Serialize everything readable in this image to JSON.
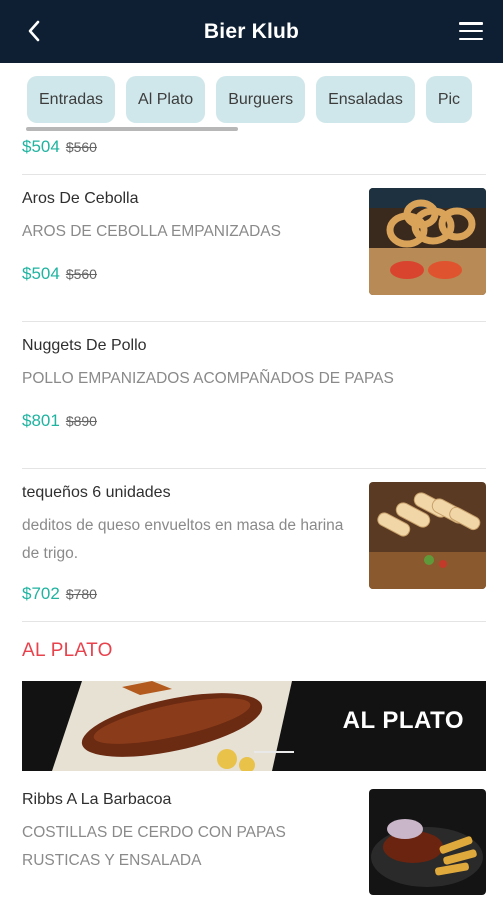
{
  "header": {
    "title": "Bier Klub",
    "back_icon": "chevron-left-icon",
    "menu_icon": "hamburger-menu-icon"
  },
  "tabs": [
    "Entradas",
    "Al Plato",
    "Burguers",
    "Ensaladas",
    "Pic"
  ],
  "items": [
    {
      "price": "$504",
      "old_price": "$560"
    },
    {
      "name": "Aros De Cebolla",
      "description": "AROS DE CEBOLLA EMPANIZADAS",
      "price": "$504",
      "old_price": "$560"
    },
    {
      "name": "Nuggets De Pollo",
      "description": "POLLO EMPANIZADOS ACOMPAÑADOS DE PAPAS",
      "price": "$801",
      "old_price": "$890"
    },
    {
      "name": "tequeños 6 unidades",
      "description": "deditos de queso envueltos en masa de harina de trigo.",
      "price": "$702",
      "old_price": "$780"
    }
  ],
  "section": {
    "title": "AL PLATO",
    "banner_label": "AL PLATO"
  },
  "plato_items": [
    {
      "name": "Ribbs A La Barbacoa",
      "description": "COSTILLAS DE CERDO CON PAPAS RUSTICAS Y ENSALADA"
    }
  ],
  "colors": {
    "header_bg": "#0f1f33",
    "tab_bg": "#cfe7ea",
    "price": "#1fb3a0",
    "section": "#e8424d"
  }
}
